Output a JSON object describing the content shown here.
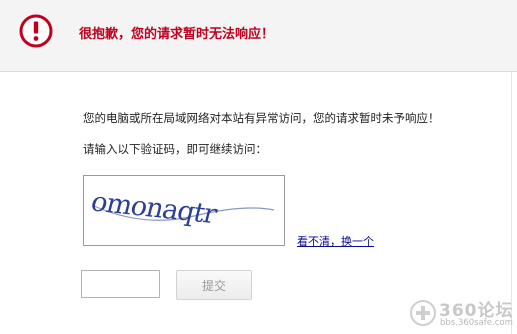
{
  "header": {
    "title": "很抱歉，您的请求暂时无法响应！",
    "icon": "alert-circle-icon",
    "accent_color": "#c0001e"
  },
  "content": {
    "message_line1": "您的电脑或所在局域网络对本站有异常访问，您的请求暂时未予响应！",
    "message_line2": "请输入以下验证码，即可继续访问：",
    "captcha_text": "omonaqtr",
    "refresh_link": "看不清，换一个"
  },
  "form": {
    "input_value": "",
    "submit_label": "提交"
  },
  "watermark": {
    "logo": "360论坛",
    "url": "bbs.360safe.com"
  }
}
